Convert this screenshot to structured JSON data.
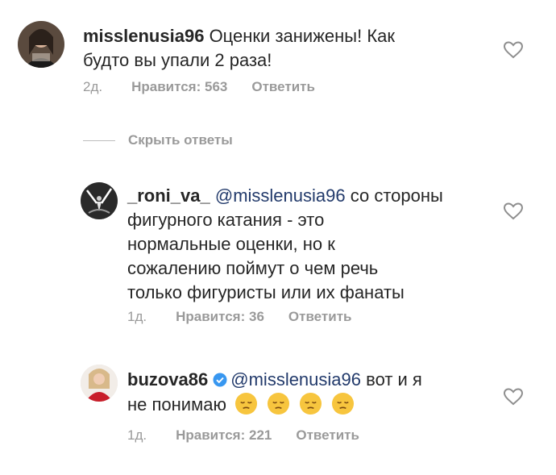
{
  "comments": [
    {
      "username": "misslenusia96",
      "line1": "Оценки занижены! Как",
      "line2": "будто вы упали 2 раза!",
      "time": "2д.",
      "likes": "Нравится: 563",
      "reply": "Ответить"
    },
    {
      "username": "_roni_va_",
      "mention": "@misslenusia96",
      "line1_rest": "со стороны",
      "line2": "фигурного катания - это",
      "line3": "нормальные оценки, но к",
      "line4": "сожалению поймут о чем речь",
      "line5": "только фигуристы или их фанаты",
      "time": "1д.",
      "likes": "Нравится: 36",
      "reply": "Ответить"
    },
    {
      "username": "buzova86",
      "mention": "@misslenusia96",
      "line1_rest": "вот и я",
      "line2": "не понимаю",
      "time": "1д.",
      "likes": "Нравится: 221",
      "reply": "Ответить"
    }
  ],
  "hide_replies_label": "Скрыть ответы",
  "icons": {
    "like": "heart-outline-icon",
    "verified": "verified-badge-icon",
    "emoji": "pensive-face-emoji"
  },
  "colors": {
    "mention": "#223a6b",
    "meta": "#9a9a9a",
    "verified": "#3897f0"
  }
}
